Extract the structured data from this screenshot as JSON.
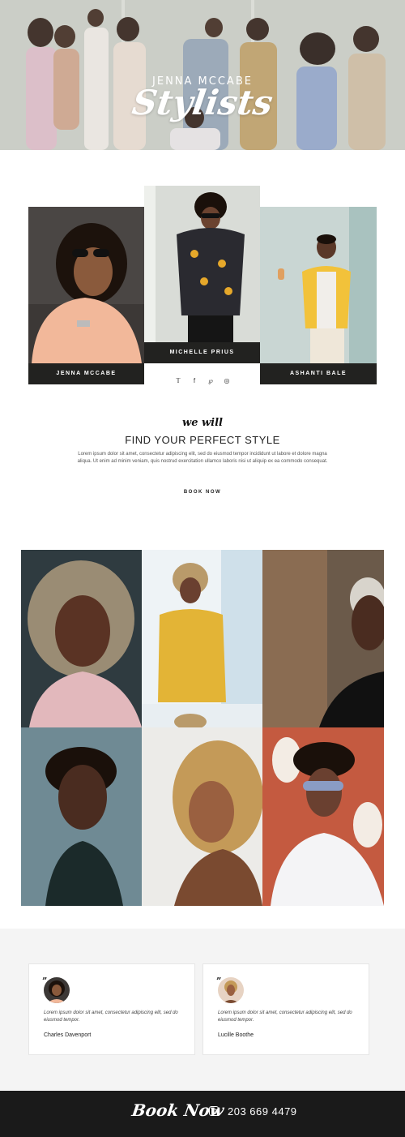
{
  "hero": {
    "subtitle": "JENNA MCCABE",
    "title": "Stylists"
  },
  "stylists": [
    {
      "name": "JENNA MCCABE"
    },
    {
      "name": "MICHELLE PRIUS"
    },
    {
      "name": "ASHANTI BALE"
    }
  ],
  "social": {
    "twitter_glyph": "𝕋",
    "facebook_glyph": "f",
    "pinterest_glyph": "℘",
    "instagram_glyph": "◎"
  },
  "intro": {
    "script_heading": "we will",
    "title": "FIND YOUR PERFECT STYLE",
    "body": "Lorem ipsum dolor sit amet, consectetur adipiscing elit, sed do eiusmod tempor incididunt ut labore et dolore magna aliqua. Ut enim ad minim veniam, quis nostrud exercitation ullamco laboris nisi ut aliquip ex ea commodo consequat.",
    "cta": "BOOK NOW"
  },
  "testimonials": [
    {
      "quote_mark": "”",
      "text": "Lorem ipsum dolor sit amet, consectetur adipiscing elit, sed do eiusmod tempor.",
      "name": "Charles Davenport"
    },
    {
      "quote_mark": "”",
      "text": "Lorem ipsum dolor sit amet, consectetur adipiscing elit, sed do eiusmod tempor.",
      "name": "Lucille Boothe"
    }
  ],
  "footer": {
    "book_label": "Book Now",
    "icon": "instagram-icon",
    "phone": "203 669 4479"
  },
  "colors": {
    "dark": "#222220",
    "footer_bg": "#1a1a1a",
    "testimonial_bg": "#f4f4f4"
  }
}
